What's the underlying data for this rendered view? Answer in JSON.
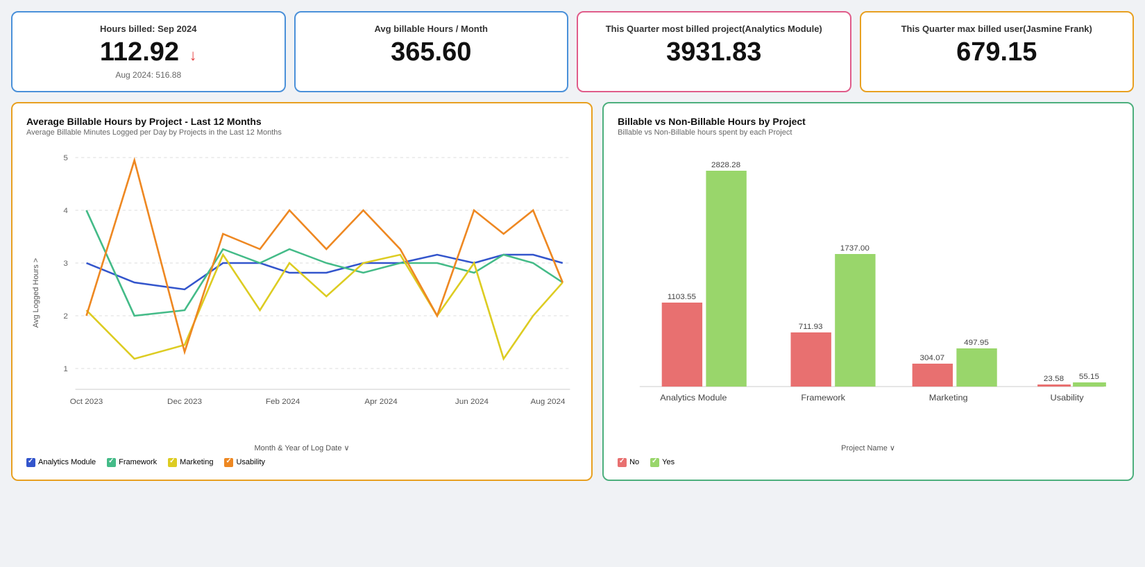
{
  "cards": [
    {
      "id": "hours-billed",
      "label": "Hours billed: Sep 2024",
      "value": "112.92",
      "hasArrow": true,
      "sub": "Aug 2024: 516.88",
      "borderClass": "card-1"
    },
    {
      "id": "avg-billable",
      "label": "Avg billable Hours / Month",
      "value": "365.60",
      "hasArrow": false,
      "sub": "",
      "borderClass": "card-2"
    },
    {
      "id": "quarter-project",
      "label": "This Quarter most billed project(Analytics Module)",
      "value": "3931.83",
      "hasArrow": false,
      "sub": "",
      "borderClass": "card-3"
    },
    {
      "id": "quarter-user",
      "label": "This Quarter max billed user(Jasmine Frank)",
      "value": "679.15",
      "hasArrow": false,
      "sub": "",
      "borderClass": "card-4"
    }
  ],
  "lineChart": {
    "title": "Average Billable Hours by Project - Last 12 Months",
    "subtitle": "Average Billable Minutes Logged per Day by Projects in the Last 12 Months",
    "xAxisLabel": "Month & Year of Log Date",
    "yAxisLabel": "Avg Logged Hours",
    "xLabels": [
      "Oct 2023",
      "Dec 2023",
      "Feb 2024",
      "Apr 2024",
      "Jun 2024",
      "Aug 2024"
    ],
    "yLabels": [
      "1",
      "2",
      "3",
      "4",
      "5"
    ],
    "legend": [
      {
        "label": "Analytics Module",
        "color": "#3355cc"
      },
      {
        "label": "Framework",
        "color": "#44bb88"
      },
      {
        "label": "Marketing",
        "color": "#ddcc22"
      },
      {
        "label": "Usability",
        "color": "#ee8822"
      }
    ]
  },
  "barChart": {
    "title": "Billable vs Non-Billable Hours by Project",
    "subtitle": "Billable vs Non-Billable hours spent by each Project",
    "xAxisLabel": "Project Name",
    "legend": [
      {
        "label": "No",
        "color": "#e87070"
      },
      {
        "label": "Yes",
        "color": "#99d66b"
      }
    ],
    "projects": [
      "Analytics Module",
      "Framework",
      "Marketing",
      "Usability"
    ],
    "noValues": [
      1103.55,
      711.93,
      304.07,
      23.58
    ],
    "yesValues": [
      2828.28,
      1737.0,
      497.95,
      55.15
    ]
  }
}
